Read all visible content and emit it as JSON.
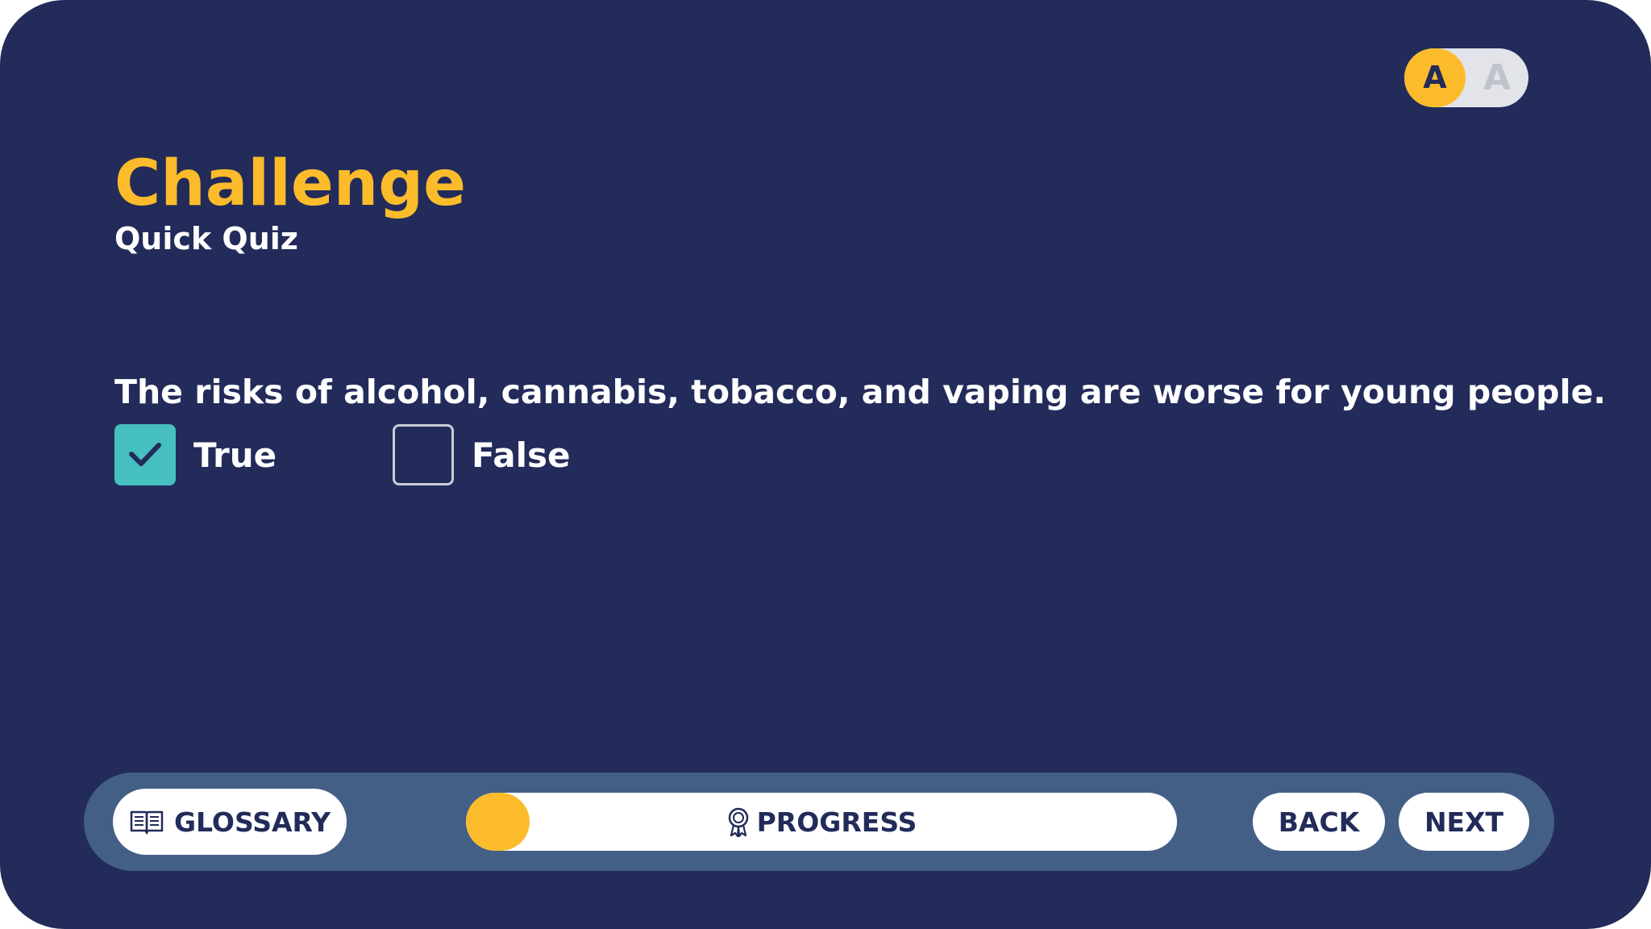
{
  "font_toggle": {
    "small_label": "A",
    "large_label": "A"
  },
  "header": {
    "title": "Challenge",
    "subtitle": "Quick Quiz"
  },
  "quiz": {
    "question": "The risks of alcohol, cannabis, tobacco, and vaping are worse for young people.",
    "options": [
      {
        "label": "True",
        "checked": true
      },
      {
        "label": "False",
        "checked": false
      }
    ]
  },
  "nav": {
    "glossary_label": "GLOSSARY",
    "progress_label": "PROGRESS",
    "progress_fraction": 0.09,
    "back_label": "BACK",
    "next_label": "NEXT"
  },
  "colors": {
    "background": "#222b5a",
    "accent": "#fbbb2b",
    "check": "#46bfc0",
    "bar": "#445f86"
  }
}
